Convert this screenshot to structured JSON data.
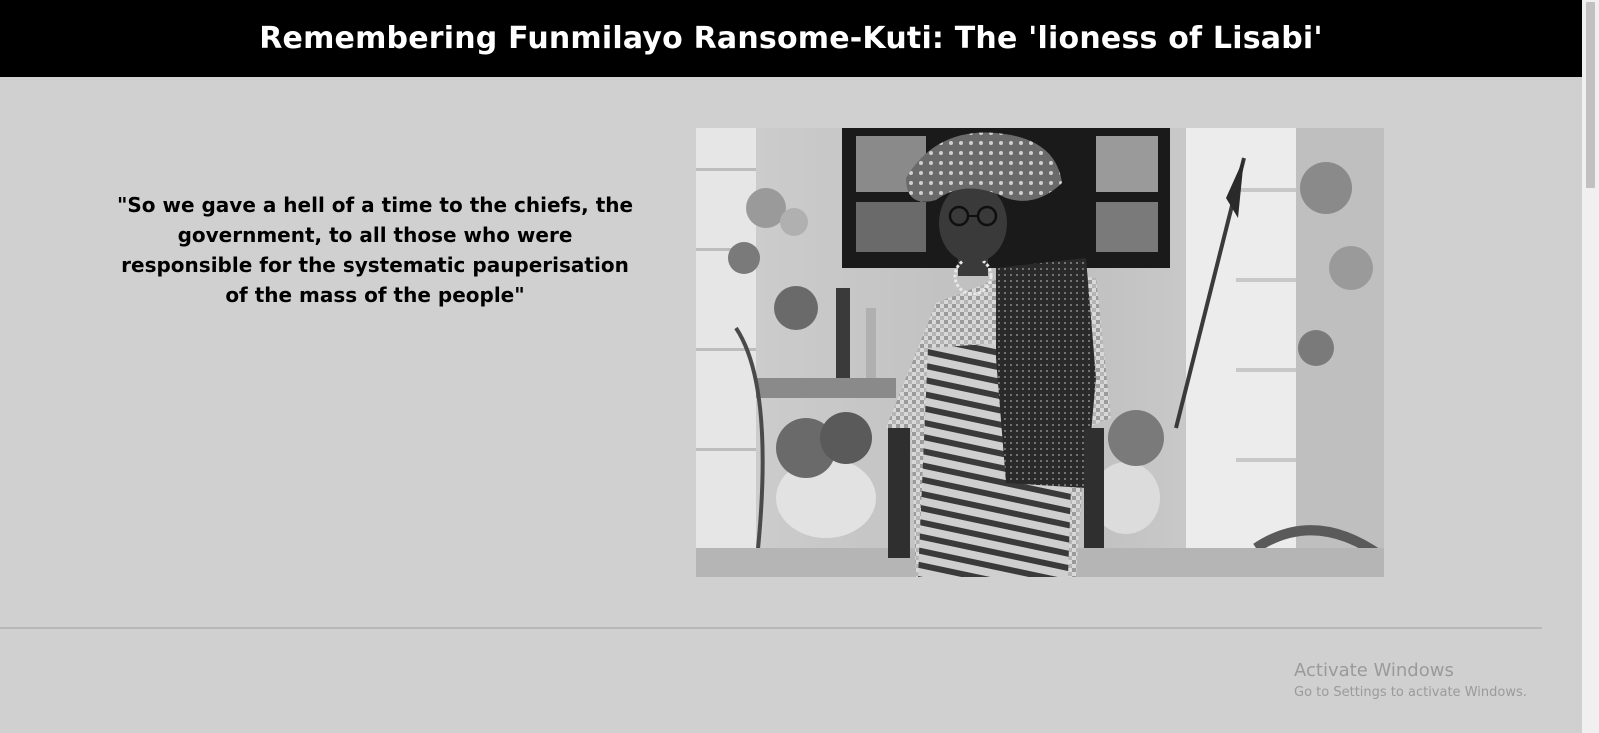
{
  "header": {
    "title": "Remembering Funmilayo Ransome-Kuti: The 'lioness of Lisabi'"
  },
  "main": {
    "quote": "\"So we gave a hell of a time to the chiefs, the government, to all those who were responsible for the systematic pauperisation of the mass of the people\""
  },
  "watermark": {
    "line1": "Activate Windows",
    "line2": "Go to Settings to activate Windows."
  },
  "colors": {
    "header_bg": "#000000",
    "page_bg": "#d0d0d0",
    "divider": "#b8b8b8"
  }
}
